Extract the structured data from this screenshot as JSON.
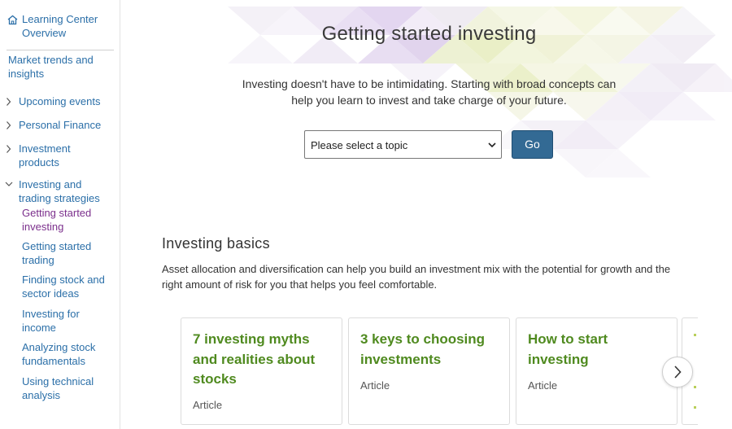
{
  "sidebar": {
    "overview_label": "Learning Center Overview",
    "overview_line1": "Learning Center",
    "overview_line2": "Overview",
    "market_line1": "Market trends and",
    "market_line2": "insights",
    "items": [
      {
        "line1": "Upcoming events",
        "line2": "",
        "expanded": false
      },
      {
        "line1": "Personal Finance",
        "line2": "",
        "expanded": false
      },
      {
        "line1": "Investment",
        "line2": "products",
        "expanded": false
      },
      {
        "line1": "Investing and",
        "line2": "trading strategies",
        "expanded": true
      }
    ],
    "subitems": [
      {
        "line1": "Getting started",
        "line2": "investing",
        "active": true
      },
      {
        "line1": "Getting started",
        "line2": "trading",
        "active": false
      },
      {
        "line1": "Finding stock and",
        "line2": "sector ideas",
        "active": false
      },
      {
        "line1": "Investing for",
        "line2": "income",
        "active": false
      },
      {
        "line1": "Analyzing stock",
        "line2": "fundamentals",
        "active": false
      },
      {
        "line1": "Using technical",
        "line2": "analysis",
        "active": false
      }
    ]
  },
  "hero": {
    "title": "Getting started investing",
    "desc_line1": "Investing doesn't have to be intimidating. Starting with broad concepts can",
    "desc_line2": "help you learn to invest and take charge of your future.",
    "select_value": "Please select a topic",
    "go_label": "Go"
  },
  "basics": {
    "title": "Investing basics",
    "desc_line1": "Asset allocation and diversification can help you build an investment mix with the potential for growth and the",
    "desc_line2": "right amount of risk for you that helps you feel comfortable."
  },
  "cards": [
    {
      "line1": "7 investing myths",
      "line2": "and realities about",
      "line3": "stocks",
      "type": "Article"
    },
    {
      "line1": "3 keys to choosing",
      "line2": "investments",
      "line3": "",
      "type": "Article"
    },
    {
      "line1": "How to start",
      "line2": "investing",
      "line3": "",
      "type": "Article"
    }
  ],
  "colors": {
    "link": "#2b6fa8",
    "active_link": "#7b2f8c",
    "card_title": "#4f8a1f",
    "go_button": "#336a94"
  },
  "icons": {
    "home": "home-icon",
    "chevron_right": "chevron-right-icon",
    "chevron_down": "chevron-down-icon",
    "next": "chevron-right-icon"
  }
}
